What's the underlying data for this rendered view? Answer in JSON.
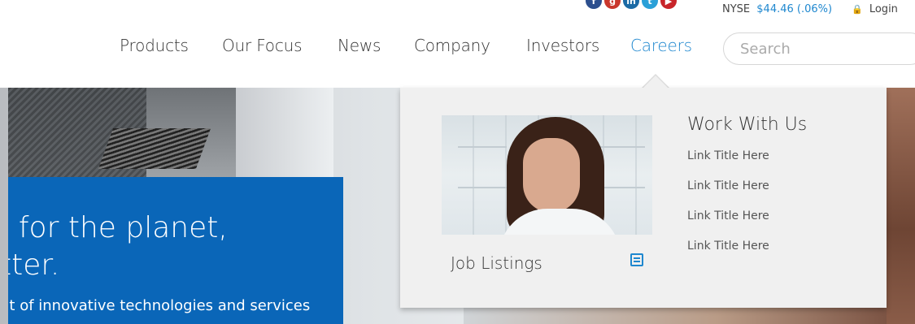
{
  "social": [
    {
      "name": "facebook-icon",
      "glyph": "f"
    },
    {
      "name": "googleplus-icon",
      "glyph": "g"
    },
    {
      "name": "linkedin-icon",
      "glyph": "in"
    },
    {
      "name": "twitter-icon",
      "glyph": "t"
    },
    {
      "name": "youtube-icon",
      "glyph": "▶"
    }
  ],
  "ticker": {
    "exchange": "NYSE",
    "price": "$44.46 (.06%)"
  },
  "login": {
    "label": "Login"
  },
  "nav": {
    "items": [
      "Products",
      "Our Focus",
      "News",
      "Company",
      "Investors",
      "Careers"
    ],
    "active": "Careers"
  },
  "search": {
    "placeholder": "Search"
  },
  "hero": {
    "line1": ", for the planet,",
    "line2": "tter.",
    "line3": "nt of innovative technologies and services"
  },
  "dropdown": {
    "promo_label": "Job Listings",
    "section_title": "Work With Us",
    "links": [
      "Link Title Here",
      "Link Title Here",
      "Link Title Here",
      "Link Title Here"
    ]
  },
  "colors": {
    "accent": "#1e87cf",
    "hero_panel": "#0a66b8",
    "dropdown_bg": "#f0f0f0"
  }
}
